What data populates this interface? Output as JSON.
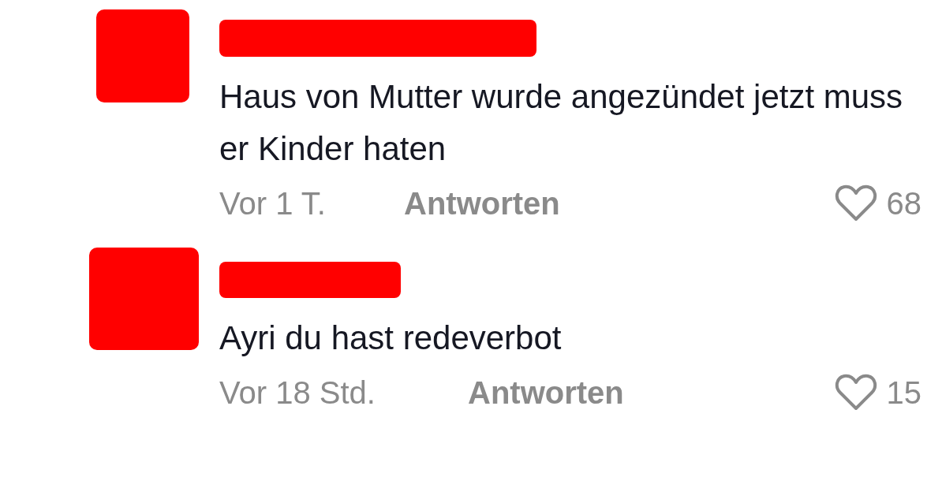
{
  "comments": [
    {
      "text": "Haus von Mutter wurde angezündet jetzt muss er Kinder haten",
      "time": "Vor 1 T.",
      "reply": "Antworten",
      "likes": "68",
      "liked": false
    },
    {
      "text": "Ayri du hast redeverbot",
      "time": "Vor 18 Std.",
      "reply": "Antworten",
      "likes": "15",
      "liked": false
    }
  ]
}
